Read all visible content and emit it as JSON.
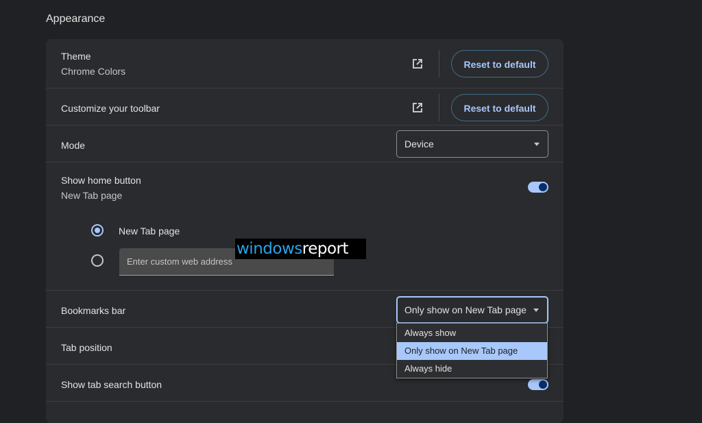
{
  "section": {
    "title": "Appearance"
  },
  "theme": {
    "label": "Theme",
    "value": "Chrome Colors",
    "reset_label": "Reset to default",
    "external_icon": "open-in-new-icon"
  },
  "toolbar": {
    "label": "Customize your toolbar",
    "reset_label": "Reset to default",
    "external_icon": "open-in-new-icon"
  },
  "mode": {
    "label": "Mode",
    "selected": "Device"
  },
  "home_button": {
    "label": "Show home button",
    "sub": "New Tab page",
    "enabled": true,
    "options": {
      "new_tab_label": "New Tab page",
      "custom_placeholder": "Enter custom web address",
      "selected": "New Tab page"
    }
  },
  "watermark": {
    "part1": "windows",
    "part2": "report"
  },
  "bookmarks_bar": {
    "label": "Bookmarks bar",
    "selected": "Only show on New Tab page",
    "options": [
      "Always show",
      "Only show on New Tab page",
      "Always hide"
    ]
  },
  "tab_position": {
    "label": "Tab position"
  },
  "tab_search": {
    "label": "Show tab search button",
    "enabled": true
  },
  "colors": {
    "background": "#202124",
    "card": "#2a2b2e",
    "accent": "#a8c7fa",
    "toggle_knob": "#062e6f"
  }
}
